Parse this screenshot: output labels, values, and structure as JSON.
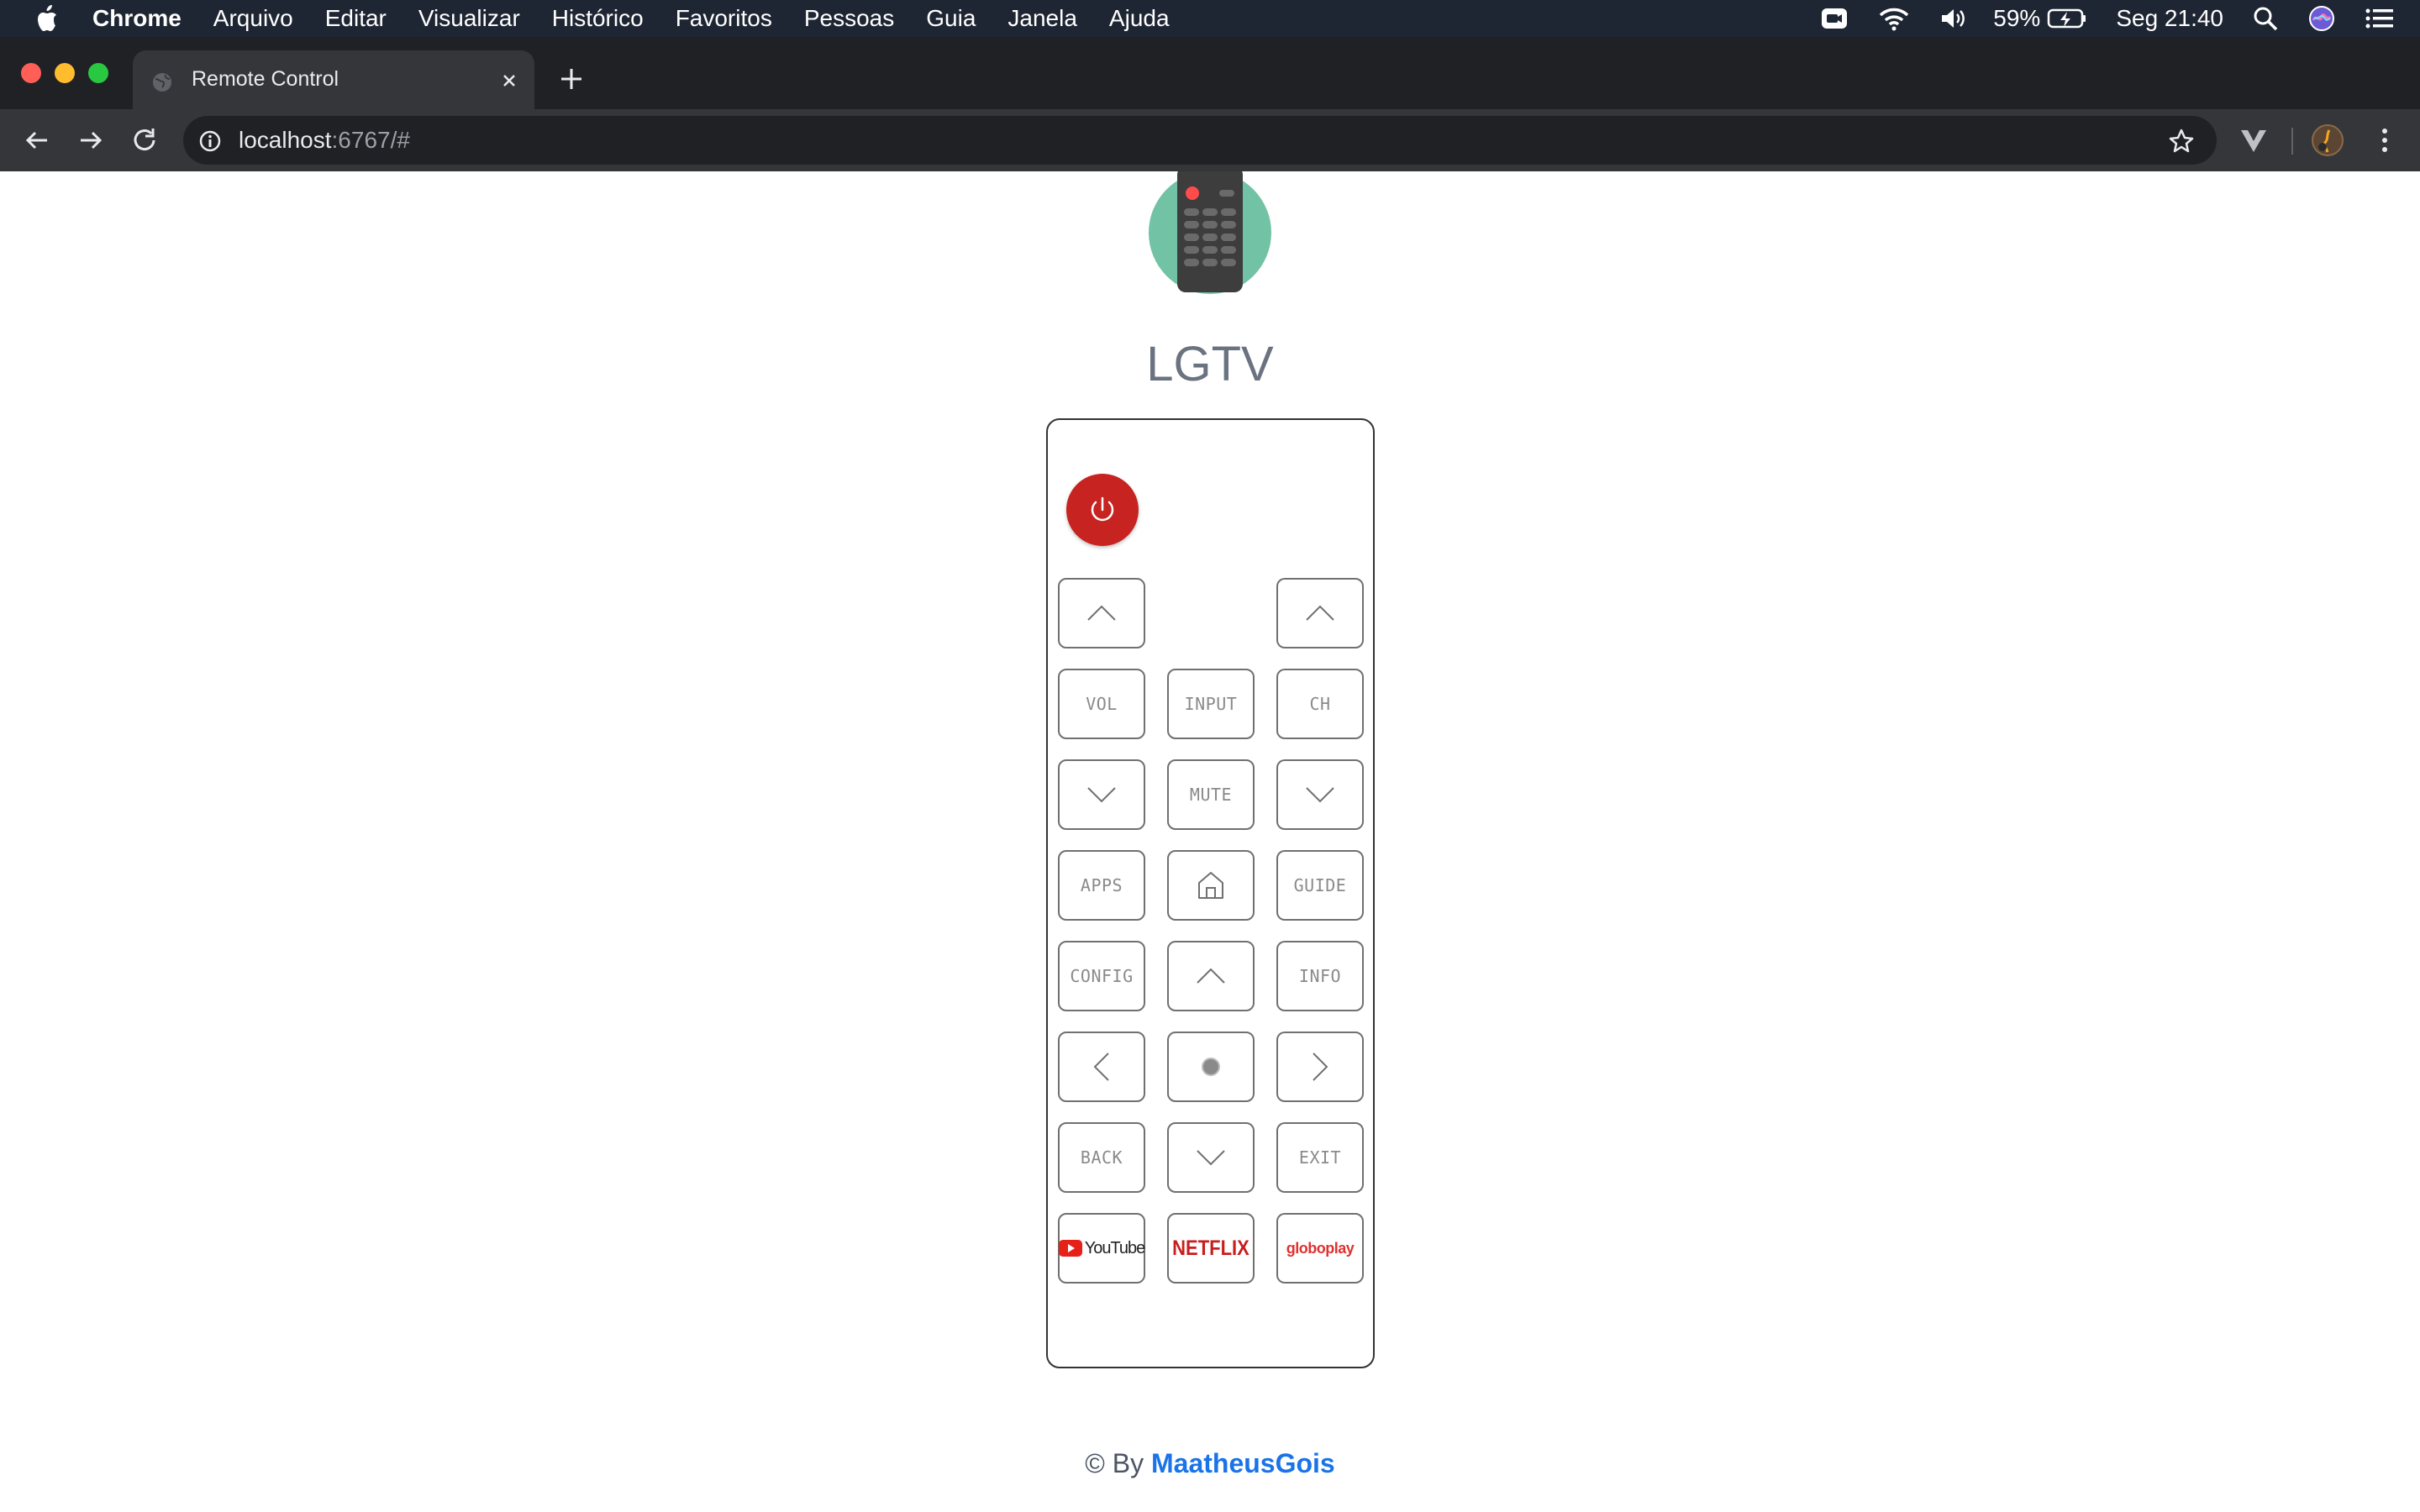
{
  "menubar": {
    "app_name": "Chrome",
    "items": [
      "Arquivo",
      "Editar",
      "Visualizar",
      "Histórico",
      "Favoritos",
      "Pessoas",
      "Guia",
      "Janela",
      "Ajuda"
    ],
    "battery": "59%",
    "clock": "Seg 21:40"
  },
  "browser": {
    "tab_title": "Remote Control",
    "url_host": "localhost",
    "url_rest": ":6767/#"
  },
  "page": {
    "title": "LGTV",
    "footer_prefix": "© By",
    "footer_link": "MaatheusGois"
  },
  "remote": {
    "vol_label": "VOL",
    "input_label": "INPUT",
    "ch_label": "CH",
    "mute_label": "MUTE",
    "apps_label": "APPS",
    "guide_label": "GUIDE",
    "config_label": "CONFIG",
    "info_label": "INFO",
    "back_label": "BACK",
    "exit_label": "EXIT",
    "youtube_label": "YouTube",
    "netflix_label": "NETFLIX",
    "globoplay_label": "globoplay"
  },
  "colors": {
    "power": "#c62321",
    "link": "#1a73e8",
    "logo_bg": "#72c2a5"
  },
  "icons": [
    "apple-icon",
    "camera-icon",
    "wifi-icon",
    "volume-icon",
    "battery-icon",
    "search-icon",
    "siri-icon",
    "list-icon",
    "globe-icon",
    "close-icon",
    "plus-icon",
    "back-arrow-icon",
    "forward-arrow-icon",
    "reload-icon",
    "info-icon",
    "star-icon",
    "vivaldi-icon",
    "profile-avatar",
    "more-icon",
    "power-icon",
    "chevron-up-icon",
    "chevron-down-icon",
    "chevron-left-icon",
    "chevron-right-icon",
    "home-icon",
    "ok-dot-icon"
  ]
}
